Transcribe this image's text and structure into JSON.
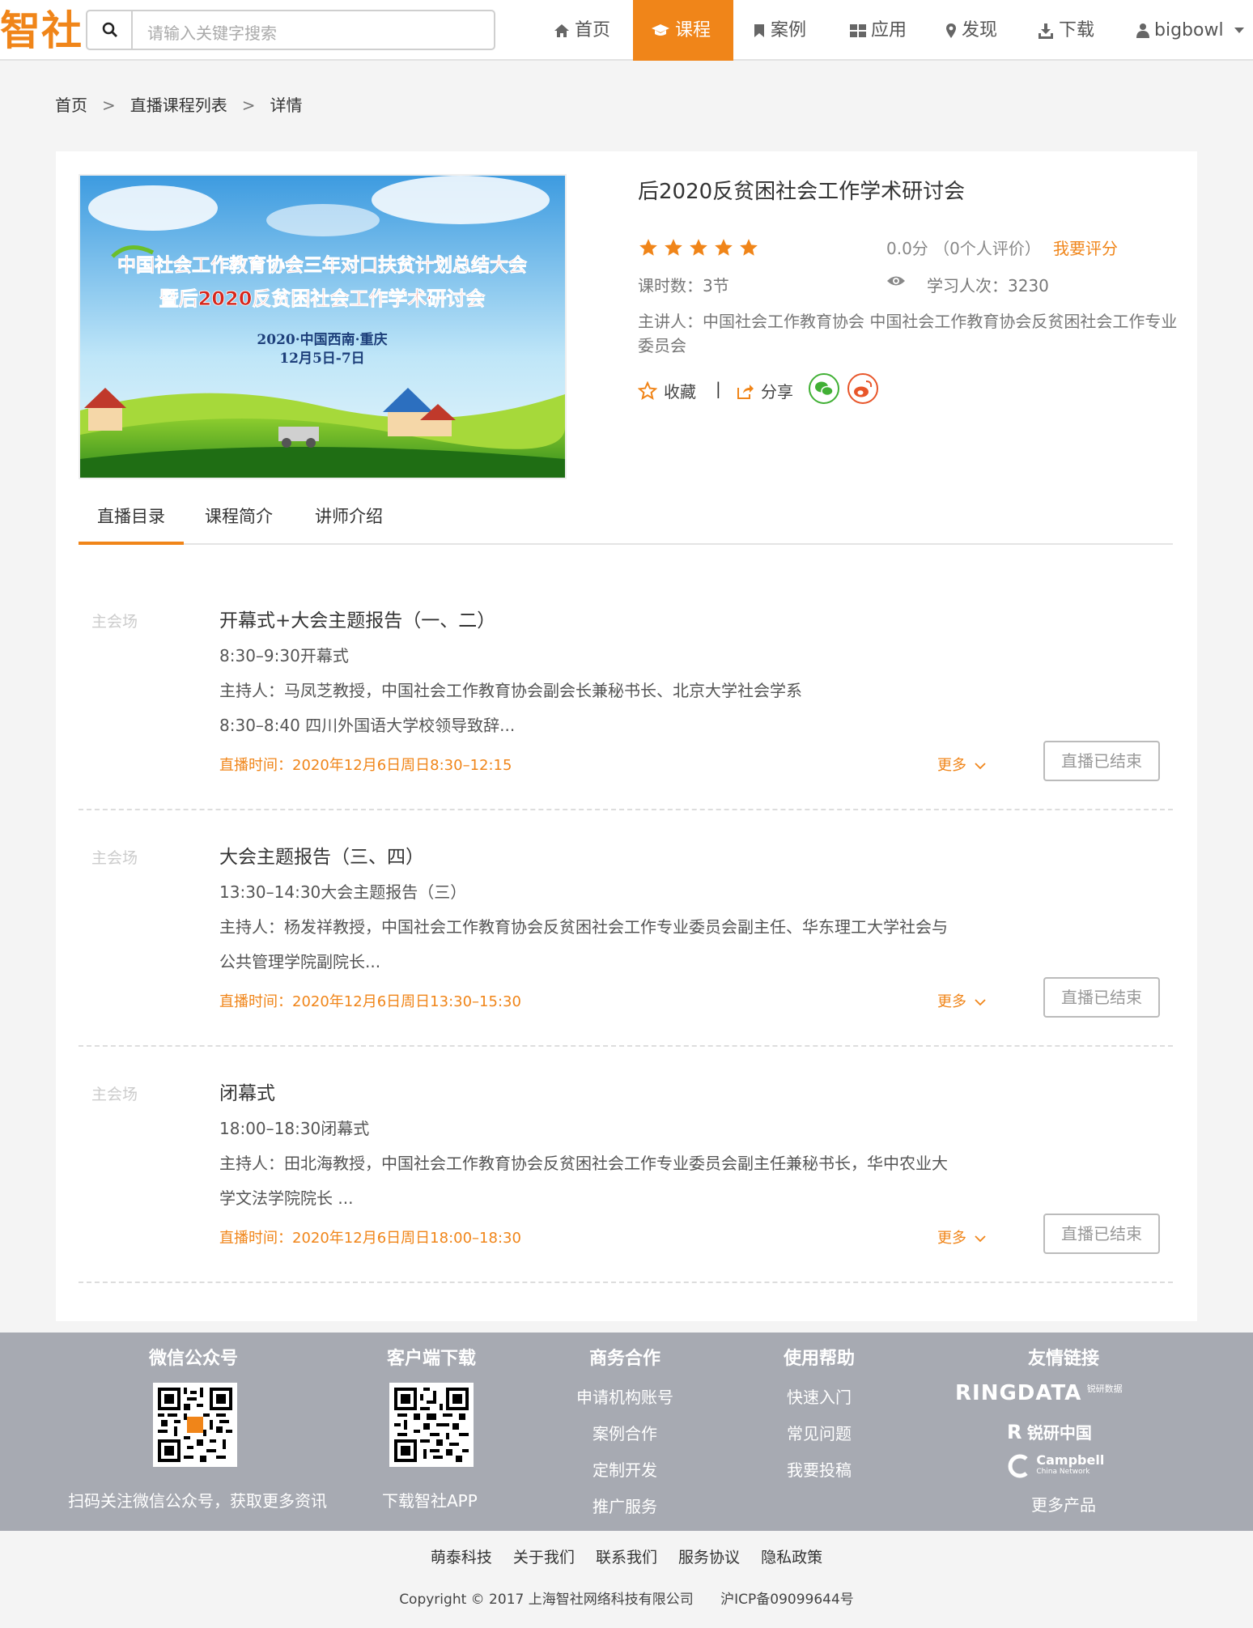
{
  "header": {
    "logo": "智社",
    "search_placeholder": "请输入关键字搜索",
    "nav": [
      {
        "label": "首页",
        "icon": "home-icon"
      },
      {
        "label": "课程",
        "icon": "graduation-cap-icon",
        "active": true
      },
      {
        "label": "案例",
        "icon": "bookmark-icon"
      },
      {
        "label": "应用",
        "icon": "grid-icon"
      },
      {
        "label": "发现",
        "icon": "map-pin-icon"
      },
      {
        "label": "下载",
        "icon": "download-icon"
      }
    ],
    "user": "bigbowl"
  },
  "breadcrumb": [
    "首页",
    "直播课程列表",
    "详情"
  ],
  "course": {
    "title": "后2020反贫困社会工作学术研讨会",
    "cover": {
      "line1": "中国社会工作教育协会三年对口扶贫计划总结大会",
      "line2": "暨后2020反贫困社会工作学术研讨会",
      "line3": "2020·中国西南·重庆",
      "line4": "12月5日-7日"
    },
    "stars": 5,
    "score": "0.0分 （0个人评价）",
    "rate_label": "我要评分",
    "hours": "课时数：3节",
    "learners": "学习人次：3230",
    "lecturer": "主讲人：中国社会工作教育协会 中国社会工作教育协会反贫困社会工作专业委员会",
    "favorite": "收藏",
    "share": "分享"
  },
  "tabs": [
    "直播目录",
    "课程简介",
    "讲师介绍"
  ],
  "sessions": [
    {
      "venue": "主会场",
      "title": "开幕式+大会主题报告（一、二）",
      "desc": [
        "8:30–9:30开幕式",
        "主持人：马凤芝教授，中国社会工作教育协会副会长兼秘书长、北京大学社会学系",
        "8:30–8:40 四川外国语大学校领导致辞..."
      ],
      "time": "直播时间：2020年12月6日周日8:30–12:15",
      "more": "更多",
      "status": "直播已结束"
    },
    {
      "venue": "主会场",
      "title": "大会主题报告（三、四）",
      "desc": [
        "13:30–14:30大会主题报告（三）",
        "主持人：杨发祥教授，中国社会工作教育协会反贫困社会工作专业委员会副主任、华东理工大学社会与",
        "公共管理学院副院长..."
      ],
      "time": "直播时间：2020年12月6日周日13:30–15:30",
      "more": "更多",
      "status": "直播已结束"
    },
    {
      "venue": "主会场",
      "title": "闭幕式",
      "desc": [
        "18:00–18:30闭幕式",
        "主持人：田北海教授，中国社会工作教育协会反贫困社会工作专业委员会副主任兼秘书长，华中农业大",
        "学文法学院院长 ..."
      ],
      "time": "直播时间：2020年12月6日周日18:00–18:30",
      "more": "更多",
      "status": "直播已结束"
    }
  ],
  "footer": {
    "wechat": {
      "title": "微信公众号",
      "caption": "扫码关注微信公众号，获取更多资讯"
    },
    "client": {
      "title": "客户端下载",
      "caption": "下载智社APP"
    },
    "business": {
      "title": "商务合作",
      "links": [
        "申请机构账号",
        "案例合作",
        "定制开发",
        "推广服务"
      ]
    },
    "help": {
      "title": "使用帮助",
      "links": [
        "快速入门",
        "常见问题",
        "我要投稿"
      ]
    },
    "friends": {
      "title": "友情链接",
      "ringdata": "RINGDATA",
      "ringdata_cn": "锐研数据",
      "ruiyan": "锐研中国",
      "campbell": "Campbell",
      "campbell_sub": "China Network",
      "more": "更多产品"
    }
  },
  "bottom": {
    "links": [
      "萌泰科技",
      "关于我们",
      "联系我们",
      "服务协议",
      "隐私政策"
    ],
    "copyright": "Copyright © 2017 上海智社网络科技有限公司",
    "icp": "沪ICP备09099644号"
  },
  "colors": {
    "accent": "#f08519",
    "footer": "#a7aab2"
  }
}
